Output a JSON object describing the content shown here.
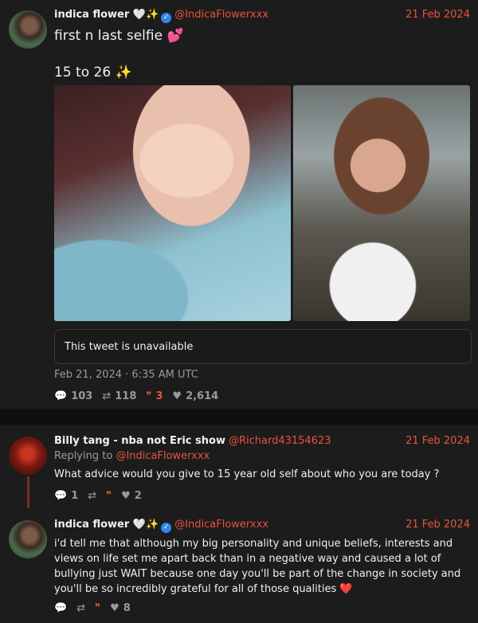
{
  "tweets": [
    {
      "name": "indica flower 🤍✨",
      "verified": true,
      "handle": "@IndicaFlowerxxx",
      "date": "21 Feb 2024",
      "text_line1": "first n last selfie 💕",
      "text_line2": "15 to 26 ✨",
      "quote_text": "This tweet is unavailable",
      "timestamp": "Feb 21, 2024 · 6:35 AM UTC",
      "stats": {
        "replies": "103",
        "retweets": "118",
        "quotes": "3",
        "likes": "2,614"
      }
    },
    {
      "name": "Billy tang - nba not Eric show",
      "handle": "@Richard43154623",
      "date": "21 Feb 2024",
      "replying_to_label": "Replying to",
      "replying_to_handle": "@IndicaFlowerxxx",
      "text": "What advice would you give to 15 year old self about who you are today ?",
      "stats": {
        "replies": "1",
        "retweets": "",
        "quotes": "",
        "likes": "2"
      }
    },
    {
      "name": "indica flower 🤍✨",
      "verified": true,
      "handle": "@IndicaFlowerxxx",
      "date": "21 Feb 2024",
      "text": "i'd tell me that although my big personality and unique beliefs, interests and views on life set me apart back than in a negative way and caused a lot of bullying just WAIT because one day you'll be part of the change in society and you'll be so incredibly grateful for all of those qualities ❤️",
      "stats": {
        "replies": "",
        "retweets": "",
        "quotes": "",
        "likes": "8"
      }
    }
  ],
  "icons": {
    "reply": "💬",
    "retweet": "⇄",
    "quote": "❞",
    "like": "♥"
  },
  "colors": {
    "accent": "#e8533e",
    "background": "#0f0f0f",
    "card": "#1c1c1c",
    "verified": "#2f8ae6"
  }
}
